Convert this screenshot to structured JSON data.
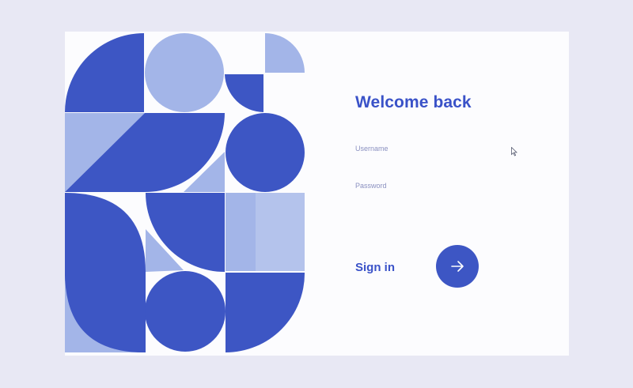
{
  "login": {
    "title": "Welcome back",
    "username_placeholder": "Username",
    "password_placeholder": "Password",
    "signin_label": "Sign in"
  },
  "icons": {
    "submit": "arrow-right-icon",
    "cursor": "mouse-pointer-icon"
  },
  "colors": {
    "background": "#e8e8f4",
    "card": "#fcfcfe",
    "primary": "#3d56c4",
    "light": "#a3b5e8",
    "text": "#3a52c8"
  }
}
